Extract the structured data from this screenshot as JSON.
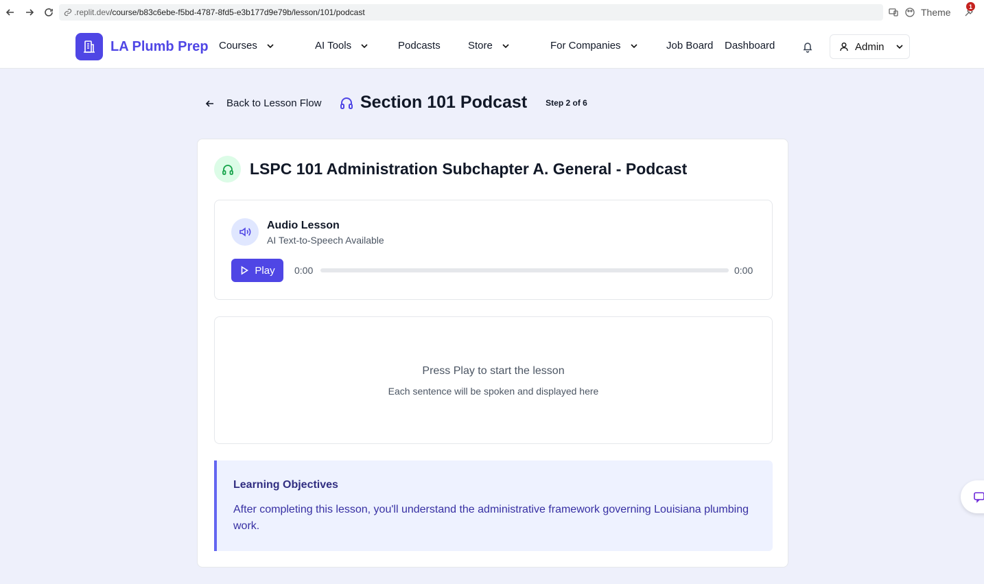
{
  "browser": {
    "url_host": ".replit.dev",
    "url_path": "/course/b83c6ebe-f5bd-4787-8fd5-e3b177d9e79b/lesson/101/podcast",
    "theme_label": "Theme",
    "notification_count": "1"
  },
  "header": {
    "logo_text": "LA Plumb Prep",
    "nav": {
      "courses": "Courses",
      "ai_tools": "AI Tools",
      "podcasts": "Podcasts",
      "store": "Store",
      "for_companies": "For Companies",
      "job_board": "Job Board",
      "dashboard": "Dashboard"
    },
    "user_label": "Admin"
  },
  "page": {
    "back_label": "Back to Lesson Flow",
    "title": "Section 101 Podcast",
    "step": "Step 2 of 6"
  },
  "card": {
    "title": "LSPC 101 Administration Subchapter A. General - Podcast",
    "audio": {
      "title": "Audio Lesson",
      "subtitle": "AI Text-to-Speech Available",
      "play_label": "Play",
      "current_time": "0:00",
      "duration": "0:00",
      "progress": 0
    },
    "transcript": {
      "main": "Press Play to start the lesson",
      "sub": "Each sentence will be spoken and displayed here"
    },
    "objectives": {
      "title": "Learning Objectives",
      "text": "After completing this lesson, you'll understand the administrative framework governing Louisiana plumbing work."
    }
  },
  "colors": {
    "accent": "#4f46e5",
    "page_bg": "#eef0fb",
    "success_bg": "#dcfce7",
    "success": "#16a34a"
  }
}
